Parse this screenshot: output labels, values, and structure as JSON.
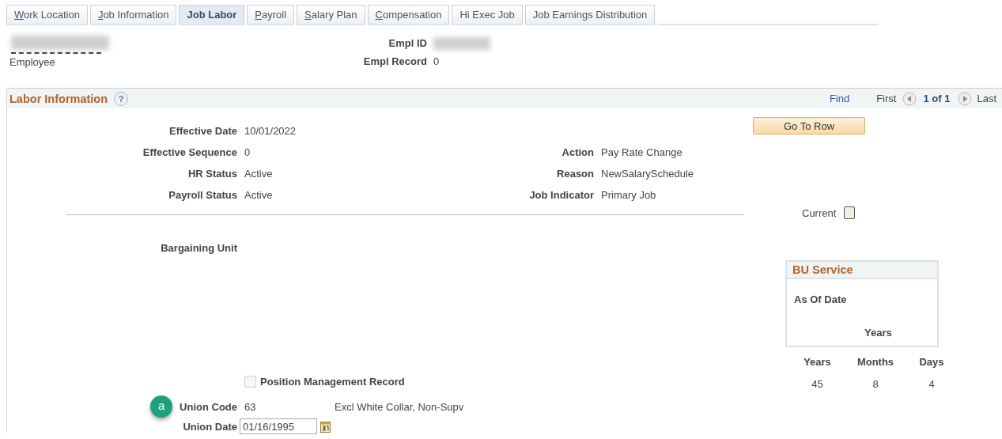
{
  "tabs": [
    {
      "label": "Work Location",
      "access_key": true,
      "selected": false
    },
    {
      "label": "Job Information",
      "access_key": true,
      "selected": false
    },
    {
      "label": "Job Labor",
      "access_key": false,
      "selected": true
    },
    {
      "label": "Payroll",
      "access_key": true,
      "selected": false
    },
    {
      "label": "Salary Plan",
      "access_key": true,
      "selected": false
    },
    {
      "label": "Compensation",
      "access_key": true,
      "selected": false
    },
    {
      "label": "Hi Exec Job",
      "access_key": false,
      "selected": false
    },
    {
      "label": "Job Earnings Distribution",
      "access_key": false,
      "selected": false
    }
  ],
  "employee": {
    "redacted": true,
    "label": "Employee"
  },
  "empl_id": {
    "label": "Empl ID",
    "redacted": true
  },
  "empl_record": {
    "label": "Empl Record",
    "value": "0"
  },
  "panel": {
    "title": "Labor Information",
    "help": "?",
    "find": "Find",
    "first": "First",
    "count": "1 of 1",
    "last": "Last"
  },
  "fields": [
    {
      "label": "Effective Date",
      "value": "10/01/2022"
    },
    {
      "label": "Effective Sequence",
      "value": "0",
      "side_label": "Action",
      "side_value": "Pay Rate Change"
    },
    {
      "label": "HR Status",
      "value": "Active",
      "side_label": "Reason",
      "side_value": "NewSalarySchedule"
    },
    {
      "label": "Payroll Status",
      "value": "Active",
      "side_label": "Job Indicator",
      "side_value": "Primary Job"
    }
  ],
  "go_to_row": "Go To Row",
  "current": {
    "label": "Current",
    "checked": false
  },
  "bargaining_unit": {
    "label": "Bargaining Unit"
  },
  "bu_service": {
    "title": "BU Service",
    "as_of_date": "As Of Date",
    "years": "Years"
  },
  "service_totals": [
    {
      "label": "Years",
      "value": "45"
    },
    {
      "label": "Months",
      "value": "8"
    },
    {
      "label": "Days",
      "value": "4"
    }
  ],
  "position_management": {
    "label": "Position Management Record",
    "checked": false,
    "disabled": true
  },
  "union_code": {
    "badge": "a",
    "label": "Union Code",
    "value": "63",
    "description": "Excl White Collar, Non-Supv"
  },
  "union_date": {
    "label": "Union Date",
    "value": "01/16/1995"
  }
}
